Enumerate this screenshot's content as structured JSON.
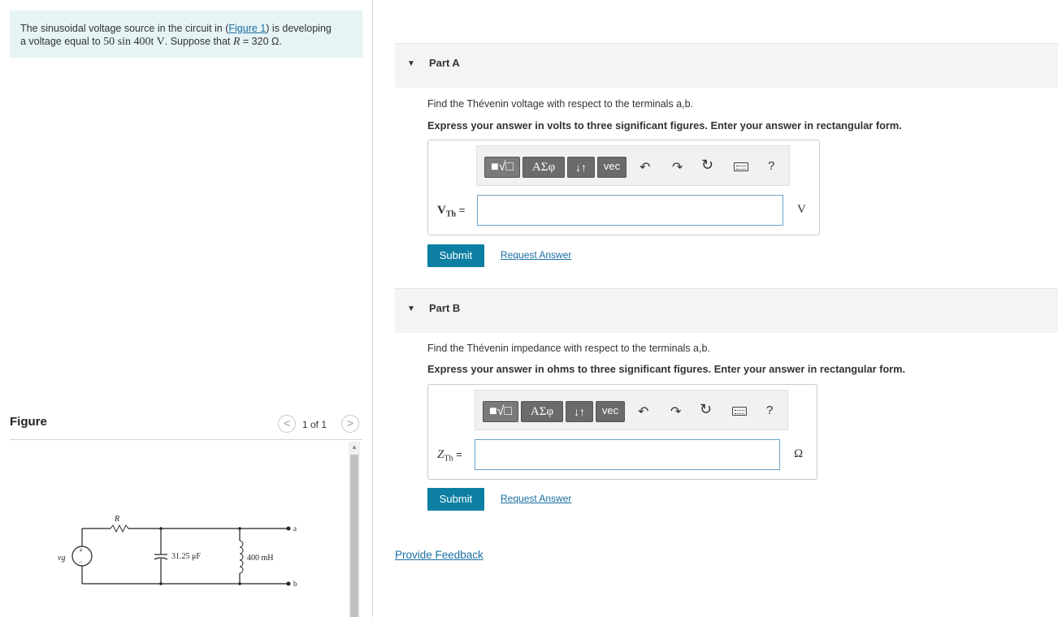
{
  "intro": {
    "text_before_link": "The sinusoidal voltage source in the circuit in (",
    "link": "Figure 1",
    "text_after_link": ") is developing",
    "line2_prefix": "a voltage equal to ",
    "voltage_expr": "50 sin 400t V",
    "line2_mid": ". Suppose that ",
    "r_expr": "R",
    "r_value": " = 320 Ω."
  },
  "figure": {
    "label": "Figure",
    "counter": "1 of 1",
    "prev": "<",
    "next": ">",
    "circuit": {
      "source": "vg",
      "resistor": "R",
      "capacitor": "31.25 μF",
      "inductor": "400 mH",
      "terminal_a": "a",
      "terminal_b": "b",
      "plus": "+",
      "minus": "−"
    }
  },
  "toolbar": {
    "templates": "■√□",
    "greek": "ΑΣφ",
    "arrows": "↓↑",
    "vec": "vec",
    "undo": "↶",
    "redo": "↷",
    "reset": "↻",
    "help": "?"
  },
  "partA": {
    "title": "Part A",
    "question": "Find the Thévenin voltage with respect to the terminals a,b.",
    "instructions": "Express your answer in volts to three significant figures. Enter your answer in rectangular form.",
    "label_main": "V",
    "label_sub": "Th",
    "label_eq": " =",
    "input_value": "",
    "unit": "V",
    "submit": "Submit",
    "request": "Request Answer"
  },
  "partB": {
    "title": "Part B",
    "question": "Find the Thévenin impedance with respect to the terminals a,b.",
    "instructions": "Express your answer in ohms to three significant figures. Enter your answer in rectangular form.",
    "label_main": "Z",
    "label_sub": "Th",
    "label_eq": " =",
    "input_value": "",
    "unit": "Ω",
    "submit": "Submit",
    "request": "Request Answer"
  },
  "feedback": "Provide Feedback",
  "colors": {
    "accent": "#0d7fa3",
    "link": "#1a6fa3",
    "intro_bg": "#e6f4f5"
  }
}
